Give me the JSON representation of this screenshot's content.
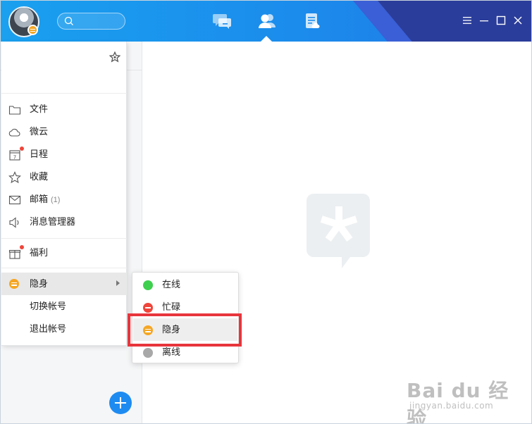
{
  "header": {
    "search_placeholder": "",
    "tabs": [
      {
        "name": "messages",
        "icon": "chat-bubble-icon",
        "active": false
      },
      {
        "name": "contacts",
        "icon": "contacts-icon",
        "active": true
      },
      {
        "name": "space",
        "icon": "document-icon",
        "active": false
      }
    ],
    "window_controls": [
      "menu-icon",
      "minimize-icon",
      "maximize-icon",
      "close-icon"
    ]
  },
  "main_menu": {
    "items": [
      {
        "id": "files",
        "label": "文件",
        "icon": "folder-icon"
      },
      {
        "id": "weiyun",
        "label": "微云",
        "icon": "cloud-icon"
      },
      {
        "id": "schedule",
        "label": "日程",
        "icon": "calendar-icon",
        "badge": true,
        "calendar_day": "7"
      },
      {
        "id": "favorites",
        "label": "收藏",
        "icon": "star-outline-icon"
      },
      {
        "id": "mailbox",
        "label": "邮箱",
        "count": "(1)",
        "icon": "mail-icon"
      },
      {
        "id": "msg-manager",
        "label": "消息管理器",
        "icon": "speaker-icon"
      },
      {
        "id": "welfare",
        "label": "福利",
        "icon": "gift-icon",
        "badge": true
      },
      {
        "id": "status",
        "label": "隐身",
        "icon": "invisible-status-icon",
        "has_submenu": true,
        "active": true
      },
      {
        "id": "switch-account",
        "label": "切换帐号"
      },
      {
        "id": "logout",
        "label": "退出帐号"
      }
    ]
  },
  "status_menu": {
    "items": [
      {
        "id": "online",
        "label": "在线",
        "color": "#3ecf4f"
      },
      {
        "id": "busy",
        "label": "忙碌",
        "color": "#f0453a"
      },
      {
        "id": "invisible",
        "label": "隐身",
        "color": "#f5a623",
        "highlighted": true
      },
      {
        "id": "offline",
        "label": "离线",
        "color": "#a8a8a8"
      }
    ]
  },
  "colors": {
    "header_start": "#1aa0ef",
    "header_end": "#2277e6",
    "accent": "#1e8bf1",
    "highlight": "#e8353c"
  },
  "watermark": {
    "main": "Bai du 经验",
    "url": "jingyan.baidu.com"
  }
}
